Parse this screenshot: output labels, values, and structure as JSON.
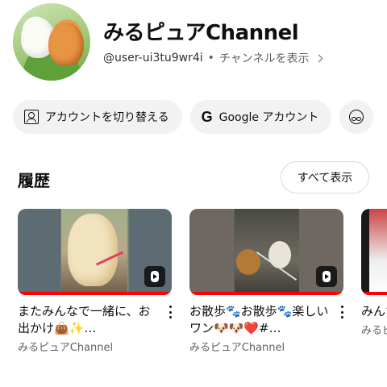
{
  "channel": {
    "name": "みるピュアChannel",
    "handle": "@user-ui3tu9wr4i",
    "separator": "•",
    "view_channel_label": "チャンネルを表示"
  },
  "chips": [
    {
      "label": "アカウントを切り替える",
      "icon": "switch-account-icon"
    },
    {
      "label": "Google アカウント",
      "icon": "google-g-icon",
      "icon_glyph": "G"
    },
    {
      "label": "",
      "icon": "incognito-icon"
    }
  ],
  "history": {
    "title": "履歴",
    "view_all_label": "すべて表示",
    "videos": [
      {
        "title": "またみんなで一緒に、お出かけ👜✨…",
        "channel": "みるピュアChannel",
        "progress_percent": 100
      },
      {
        "title": "お散歩🐾お散歩🐾楽しいワン🐶🐶❤️#…",
        "channel": "みるピュアChannel",
        "progress_percent": 100
      },
      {
        "title": "みんなで楽しい…",
        "channel": "みるピュアChannel",
        "progress_percent": 100
      }
    ]
  },
  "colors": {
    "progress": "#ff0000",
    "chip_bg": "#f2f2f2",
    "secondary_text": "#606060"
  }
}
